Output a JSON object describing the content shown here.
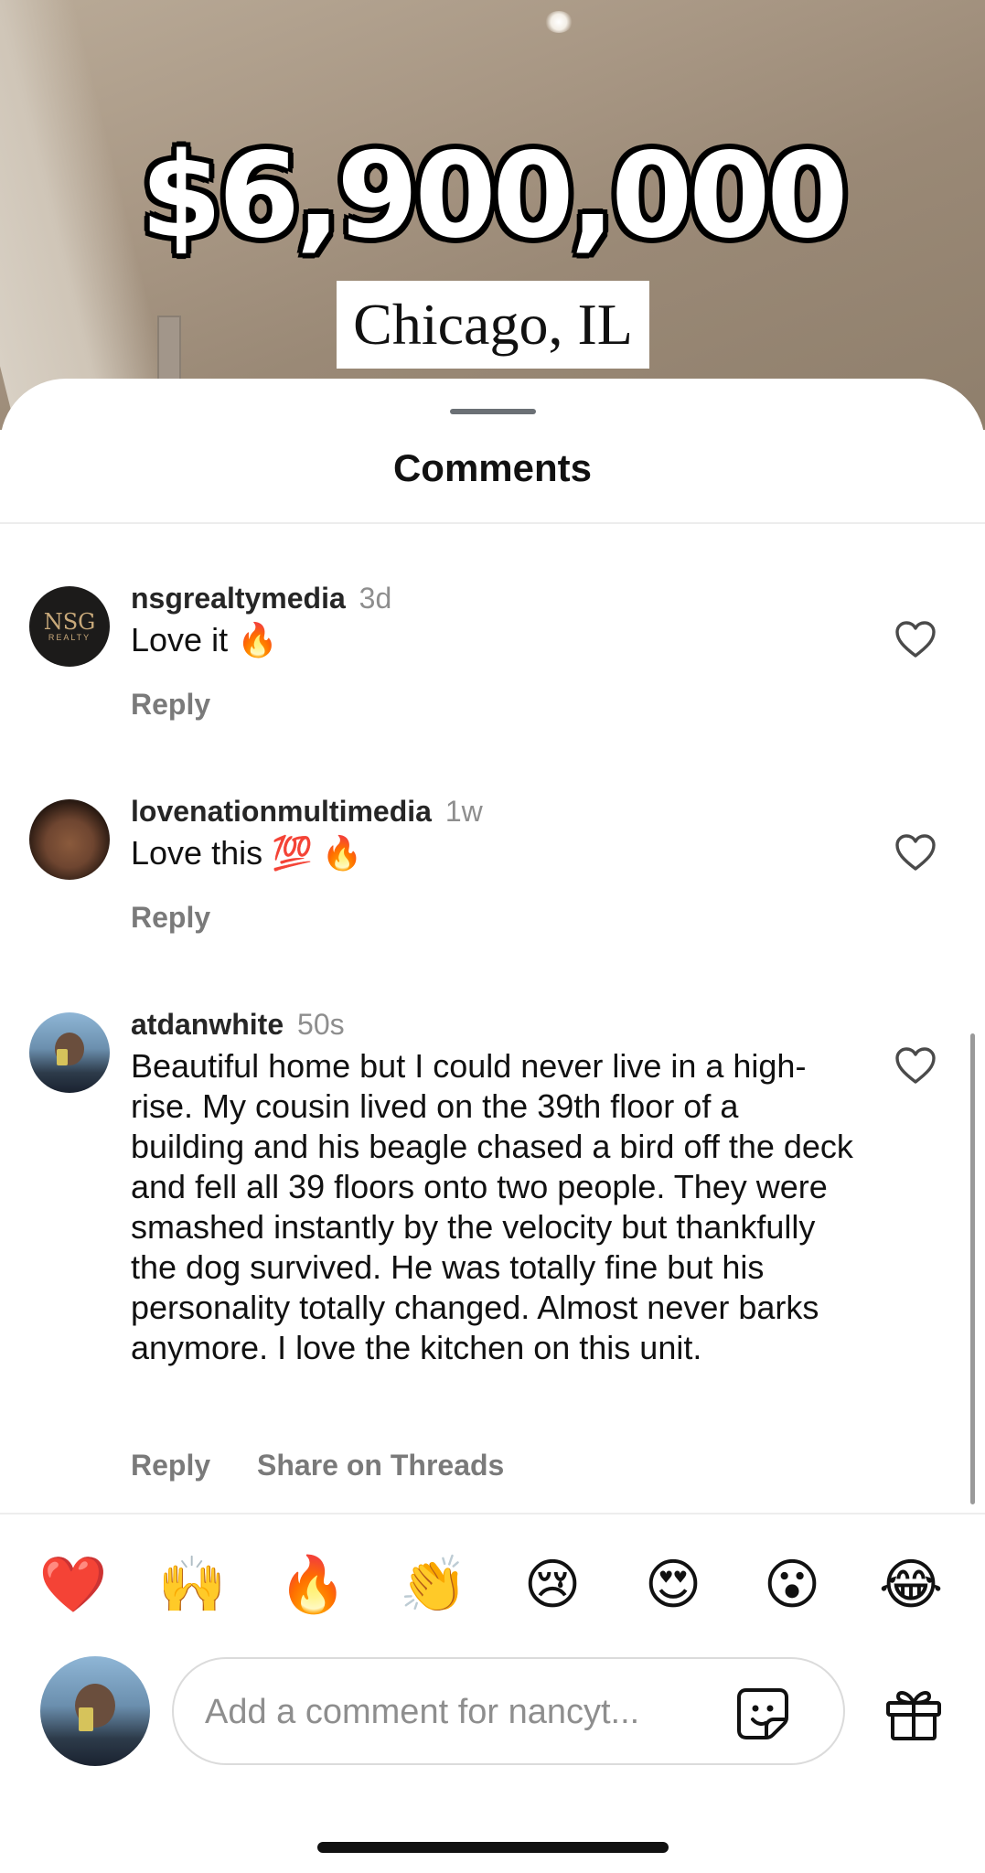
{
  "overlay": {
    "price": "$6,900,000",
    "location": "Chicago, IL"
  },
  "sheet": {
    "title": "Comments"
  },
  "comments": [
    {
      "username": "nsgrealtymedia",
      "time": "3d",
      "text": "Love it 🔥",
      "actions": [
        "Reply"
      ],
      "avatar_text": "NSG",
      "avatar_sub": "REALTY"
    },
    {
      "username": "lovenationmultimedia",
      "time": "1w",
      "text": "Love this 💯 🔥",
      "actions": [
        "Reply"
      ]
    },
    {
      "username": "atdanwhite",
      "time": "50s",
      "text": "Beautiful home but I could never live in a high-rise. My cousin lived on the 39th floor of a building and his beagle chased a bird off the deck and fell all 39 floors onto two people. They were smashed instantly by the velocity but thankfully the dog survived. He was totally fine but his personality totally changed. Almost never barks anymore.  I love the kitchen on this unit.",
      "actions": [
        "Reply",
        "Share on Threads"
      ]
    }
  ],
  "reactions": [
    "❤️",
    "🙌",
    "🔥",
    "👏",
    "😢",
    "😍",
    "😮",
    "😂"
  ],
  "composer": {
    "placeholder": "Add a comment for nancyt..."
  },
  "icons": {
    "like": "heart-outline-icon",
    "sticker": "sticker-icon",
    "gift": "gift-icon"
  }
}
